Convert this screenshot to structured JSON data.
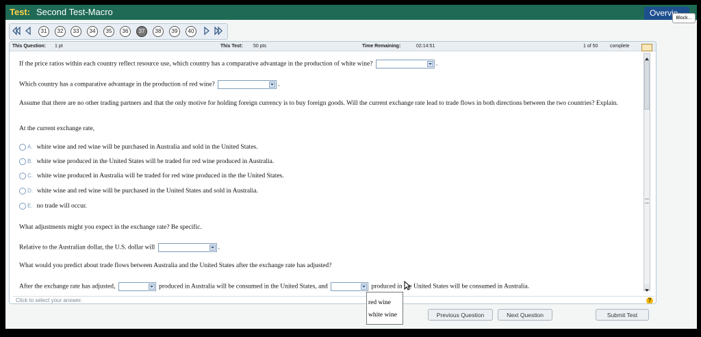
{
  "titlebar": {
    "test_label": "Test:",
    "test_name": "Second Test-Macro",
    "overview_label": "Overvie",
    "block_label": "Block..."
  },
  "nav": {
    "questions": [
      "31",
      "32",
      "33",
      "34",
      "35",
      "36",
      "37",
      "38",
      "39",
      "40"
    ],
    "current": "37"
  },
  "info": {
    "this_question_label": "This Question:",
    "this_question_value": "1 pt",
    "this_test_label": "This Test:",
    "this_test_value": "50 pts",
    "time_label": "Time Remaining:",
    "time_value": "02:14:51",
    "progress_text": "1 of 50",
    "complete_label": "complete"
  },
  "question": {
    "q1": "If the price ratios within each country reflect resource use, which country has a comparative advantage in the production of white wine?",
    "q2": "Which country has a comparative advantage in the production of red wine?",
    "q3": "Assume that there are no other trading partners and that the only motive for holding foreign currency  is to buy foreign goods.  Will the current exchange rate lead to trade flows in both directions between the two countries?  Explain.",
    "q4": "At the current exchange rate,",
    "options": [
      {
        "letter": "A.",
        "text": "white wine and red wine will be purchased in Australia and sold in the United States."
      },
      {
        "letter": "B.",
        "text": "white wine produced in the United States will be traded for red wine produced in Australia."
      },
      {
        "letter": "C.",
        "text": "white wine produced in Australia will be traded for red wine produced in the the United States."
      },
      {
        "letter": "D.",
        "text": "white wine and red wine will be purchased in the United States and sold in Australia."
      },
      {
        "letter": "E.",
        "text": "no trade will occur."
      }
    ],
    "q5": "What adjustments might you expect in the exchange rate?  Be specific.",
    "q6": "Relative to the Australian dollar, the U.S. dollar will",
    "q7": "What would you predict about trade flows between Australia and the United States after the exchange rate has adjusted?",
    "q8a": "After the exchange rate has adjusted,",
    "q8b": "produced in Australia will be consumed in the United States, and",
    "q8c": "produced in the United States will be consumed in Australia.",
    "period": "."
  },
  "dropdown_options": [
    "red wine",
    "white wine"
  ],
  "footer": {
    "hint": "Click to select your answer.",
    "help": "?"
  },
  "buttons": {
    "previous": "Previous Question",
    "next": "Next Question",
    "submit": "Submit Test"
  }
}
